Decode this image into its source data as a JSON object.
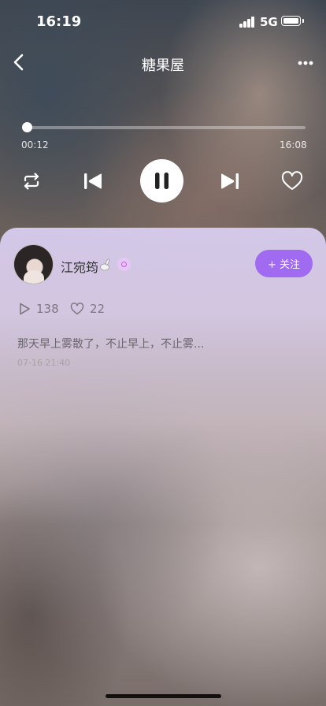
{
  "status_bar": {
    "time": "16:19",
    "network": "5G"
  },
  "nav": {
    "title": "糖果屋"
  },
  "player": {
    "current_time": "00:12",
    "total_time": "16:08",
    "progress": 0.0124
  },
  "profile": {
    "name": "江宛筠",
    "follow_label": "+ 关注",
    "plays": "138",
    "likes": "22",
    "description": "那天早上雾散了，不止早上，不止雾...",
    "date": "07-16 21:40"
  },
  "icons": {
    "back": "chevron-left-icon",
    "more": "more-horizontal-icon",
    "repeat": "repeat-icon",
    "prev": "skip-previous-icon",
    "pause": "pause-icon",
    "next": "skip-next-icon",
    "like": "heart-outline-icon",
    "play_count": "play-outline-icon",
    "like_count": "heart-outline-icon"
  },
  "colors": {
    "accent": "#a06bf1",
    "card_tint": "#d6cbec"
  }
}
